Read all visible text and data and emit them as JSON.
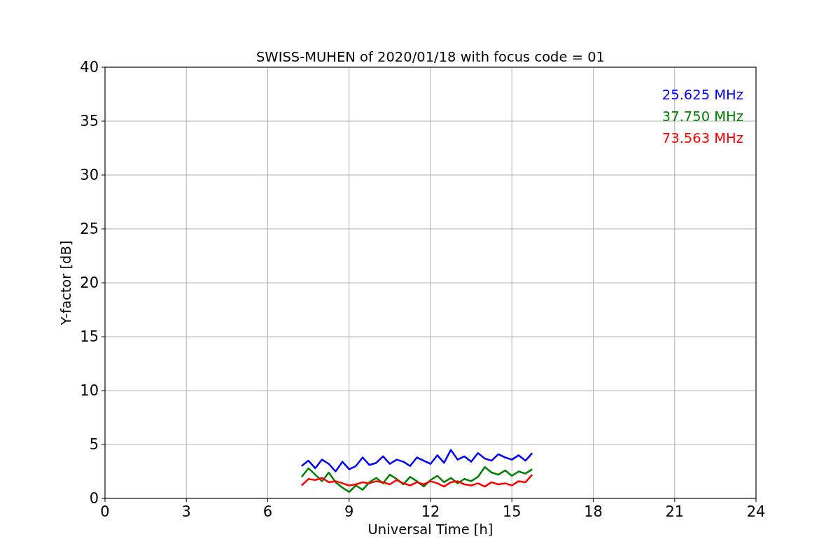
{
  "chart_data": {
    "type": "line",
    "title": "SWISS-MUHEN of 2020/01/18 with focus code = 01",
    "xlabel": "Universal Time [h]",
    "ylabel": "Y-factor [dB]",
    "x": [
      7.25,
      7.5,
      7.75,
      8,
      8.25,
      8.5,
      8.75,
      9,
      9.25,
      9.5,
      9.75,
      10,
      10.25,
      10.5,
      10.75,
      11,
      11.25,
      11.5,
      11.75,
      12,
      12.25,
      12.5,
      12.75,
      13,
      13.25,
      13.5,
      13.75,
      14,
      14.25,
      14.5,
      14.75,
      15,
      15.25,
      15.5,
      15.75
    ],
    "series": [
      {
        "name": "25.625 MHz",
        "color": "#0000ff",
        "values": [
          3.0,
          3.5,
          2.8,
          3.6,
          3.2,
          2.5,
          3.4,
          2.7,
          3.0,
          3.8,
          3.1,
          3.3,
          3.9,
          3.2,
          3.6,
          3.4,
          3.0,
          3.8,
          3.5,
          3.2,
          4.0,
          3.3,
          4.5,
          3.6,
          3.9,
          3.4,
          4.2,
          3.7,
          3.5,
          4.1,
          3.8,
          3.6,
          4.0,
          3.5,
          4.2
        ]
      },
      {
        "name": "37.750 MHz",
        "color": "#008000",
        "values": [
          2.0,
          2.8,
          2.2,
          1.6,
          2.4,
          1.5,
          1.0,
          0.6,
          1.2,
          0.8,
          1.5,
          1.9,
          1.4,
          2.2,
          1.8,
          1.3,
          2.0,
          1.6,
          1.1,
          1.7,
          2.1,
          1.5,
          1.9,
          1.4,
          1.8,
          1.6,
          2.0,
          2.9,
          2.4,
          2.2,
          2.6,
          2.1,
          2.5,
          2.3,
          2.7
        ]
      },
      {
        "name": "73.563 MHz",
        "color": "#ff0000",
        "values": [
          1.2,
          1.8,
          1.7,
          1.9,
          1.5,
          1.6,
          1.4,
          1.2,
          1.3,
          1.5,
          1.4,
          1.6,
          1.5,
          1.3,
          1.7,
          1.4,
          1.2,
          1.5,
          1.3,
          1.6,
          1.4,
          1.1,
          1.5,
          1.6,
          1.3,
          1.2,
          1.4,
          1.1,
          1.5,
          1.3,
          1.4,
          1.2,
          1.6,
          1.5,
          2.2
        ]
      }
    ],
    "grid": true,
    "xlim": [
      0,
      24
    ],
    "ylim": [
      0,
      40
    ],
    "xticks": [
      0,
      3,
      6,
      9,
      12,
      15,
      18,
      21,
      24
    ],
    "yticks": [
      0,
      5,
      10,
      15,
      20,
      25,
      30,
      35,
      40
    ]
  }
}
